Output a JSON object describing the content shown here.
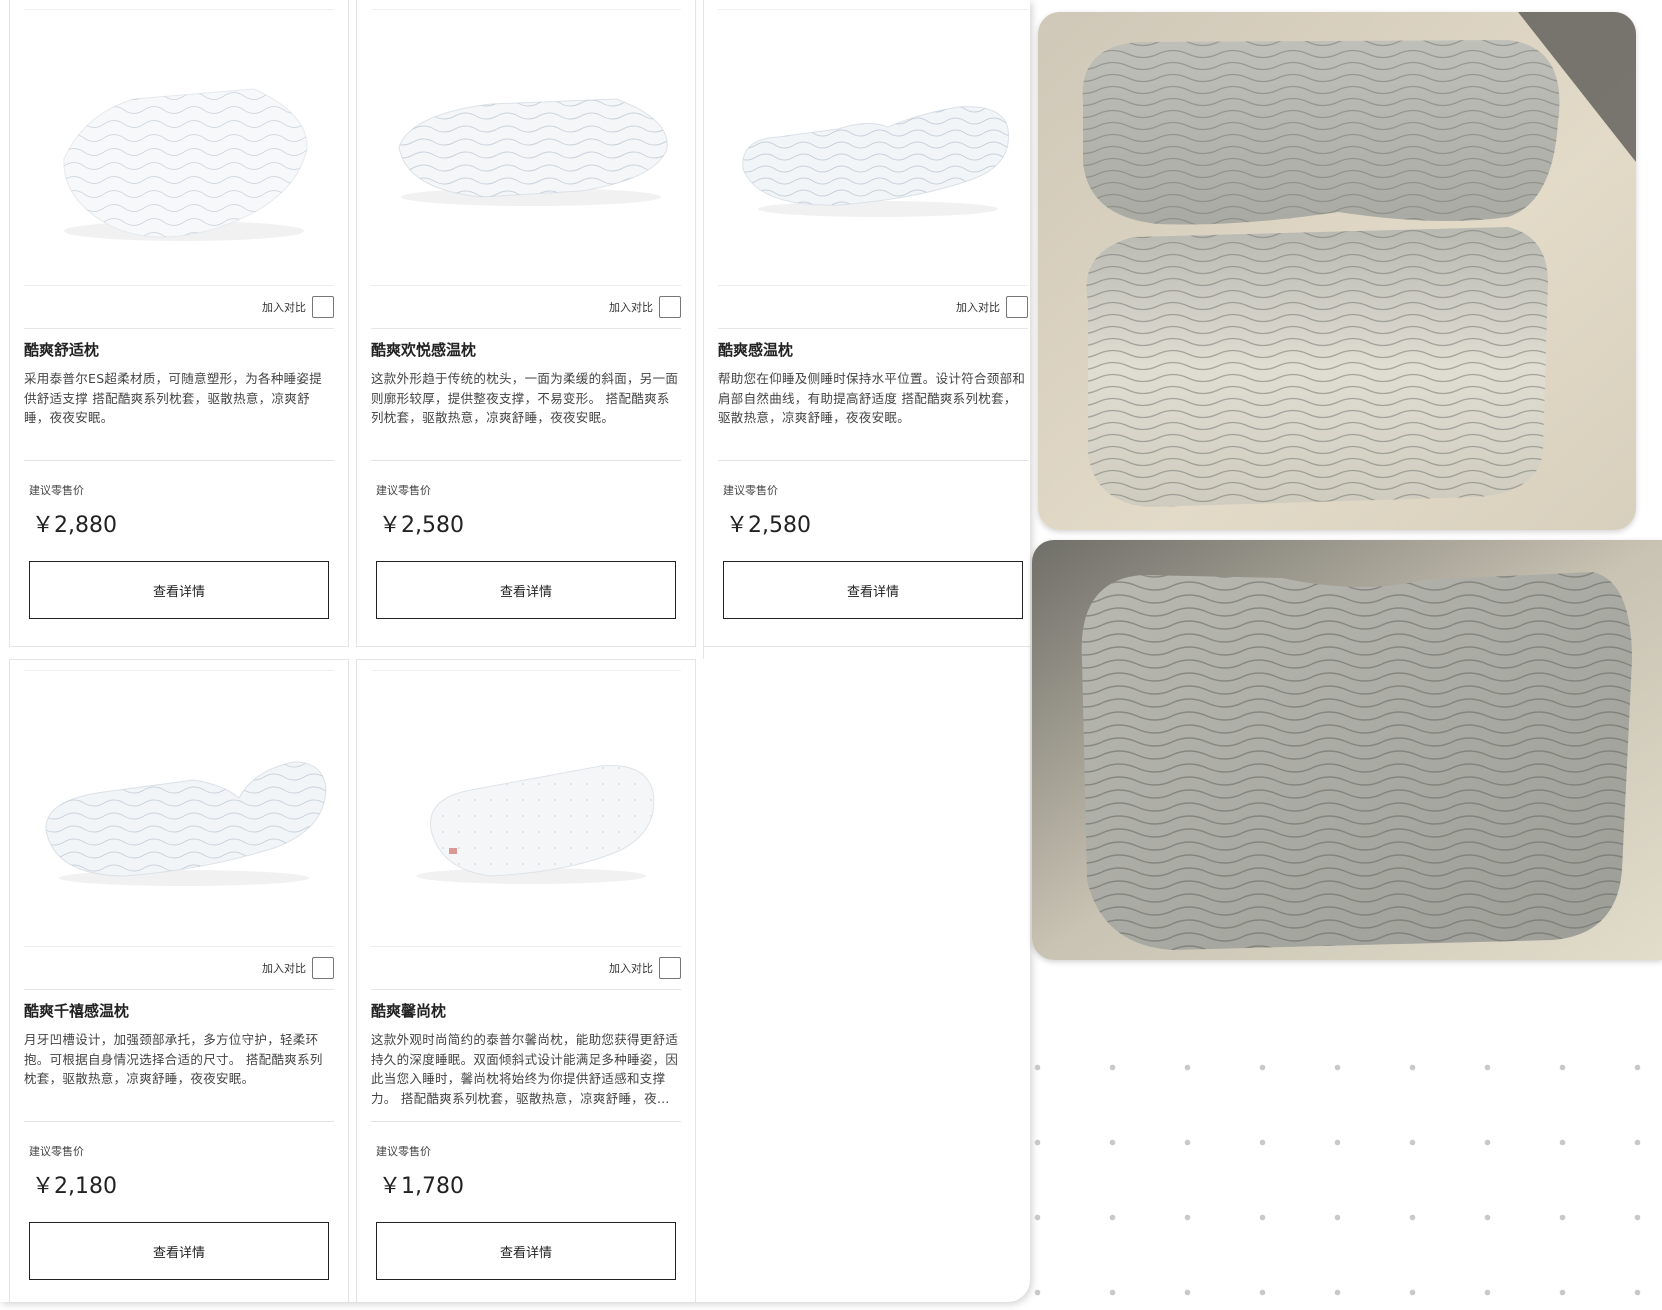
{
  "compare_label": "加入对比",
  "price_label": "建议零售价",
  "detail_button": "查看详情",
  "products": [
    {
      "name": "酷爽舒适枕",
      "description": "采用泰普尔ES超柔材质，可随意塑形，为各种睡姿提供舒适支撑 搭配酷爽系列枕套，驱散热意，凉爽舒睡，夜夜安眠。",
      "price": "￥2,880"
    },
    {
      "name": "酷爽欢悦感温枕",
      "description": "这款外形趋于传统的枕头，一面为柔缓的斜面，另一面则廓形较厚，提供整夜支撑，不易变形。 搭配酷爽系列枕套，驱散热意，凉爽舒睡，夜夜安眠。",
      "price": "￥2,580"
    },
    {
      "name": "酷爽感温枕",
      "description": "帮助您在仰睡及侧睡时保持水平位置。设计符合颈部和肩部自然曲线，有助提高舒适度 搭配酷爽系列枕套，驱散热意，凉爽舒睡，夜夜安眠。",
      "price": "￥2,580"
    },
    {
      "name": "酷爽千禧感温枕",
      "description": "月牙凹槽设计，加强颈部承托，多方位守护，轻柔环抱。可根据自身情况选择合适的尺寸。 搭配酷爽系列枕套，驱散热意，凉爽舒睡，夜夜安眠。",
      "price": "￥2,180"
    },
    {
      "name": "酷爽馨尚枕",
      "description": "这款外观时尚简约的泰普尔馨尚枕，能助您获得更舒适持久的深度睡眠。双面倾斜式设计能满足多种睡姿，因此当您入睡时，馨尚枕将始终为你提供舒适感和支撑力。 搭配酷爽系列枕套，驱散热意，凉爽舒睡，夜夜安眠。",
      "price": "￥1,780"
    }
  ]
}
